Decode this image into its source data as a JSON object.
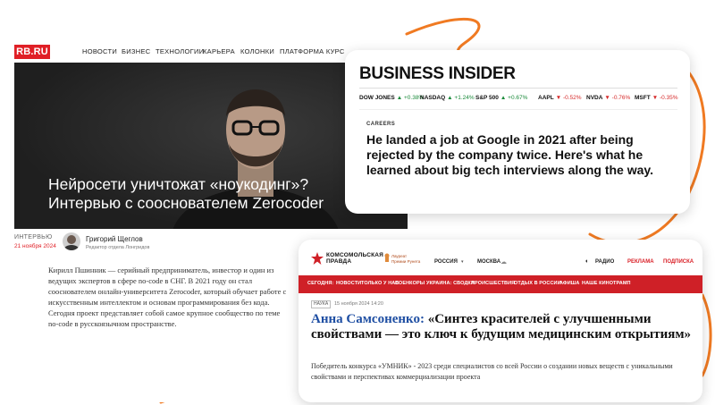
{
  "colors": {
    "accent_orange": "#f07a22",
    "rb_red": "#e01f26",
    "kp_red": "#cf2027",
    "bi_green": "#1a8a3a",
    "bi_red": "#d62b2b"
  },
  "rb": {
    "logo": "RB.RU",
    "nav": [
      "НОВОСТИ",
      "БИЗНЕС",
      "ТЕХНОЛОГИИ",
      "КАРЬЕРА",
      "КОЛОНКИ",
      "ПЛАТФОРМА КУРС"
    ],
    "headline_line1": "Нейросети уничтожат «ноукодинг»?",
    "headline_line2": "Интервью с сооснователем Zerocoder",
    "rubric": "ИНТЕРВЬЮ",
    "date": "21 ноября 2024",
    "author": "Григорий Щеглов",
    "author_role": "Редактор отдела Лонгридов",
    "lead": "Кирилл Пшинник — серийный предприниматель, инвестор и один из ведущих экспертов в сфере no-code в СНГ. В 2021 году он стал сооснователем онлайн-университета Zerocoder, который обучает работе с искусственным интеллектом и основам программирования без кода. Сегодня проект представляет собой самое крупное сообщество по теме no-code в русскоязычном пространстве."
  },
  "bi": {
    "logo": "BUSINESS INSIDER",
    "tickers": [
      {
        "name": "DOW JONES",
        "change": "+0.38%",
        "dir": "up"
      },
      {
        "name": "NASDAQ",
        "change": "+1.24%",
        "dir": "up"
      },
      {
        "name": "S&P 500",
        "change": "+0.67%",
        "dir": "up"
      },
      {
        "name": "AAPL",
        "change": "-0.52%",
        "dir": "down"
      },
      {
        "name": "NVDA",
        "change": "-0.76%",
        "dir": "down"
      },
      {
        "name": "MSFT",
        "change": "-0.35%",
        "dir": "down"
      }
    ],
    "section": "CAREERS",
    "title": "He landed a job at Google in 2021 after being rejected by the company twice. Here's what he learned about big tech interviews along the way."
  },
  "kp": {
    "logo_line1": "КОМСОМОЛЬСКАЯ",
    "logo_line2": "ПРАВДА",
    "prize_line1": "Лауреат",
    "prize_line2": "Премии Рунета",
    "region": "РОССИЯ",
    "city": "МОСКВА",
    "radio": "РАДИО",
    "ads": "РЕКЛАМА",
    "subscribe": "ПОДПИСКА",
    "nav": [
      "СЕГОДНЯ:",
      "НОВОСТИ",
      "ТОЛЬКО У НАС",
      "ВОЕНКОРЫ",
      "УКРАИНА: СВОДКА",
      "ПРОИСШЕСТВИЯ",
      "ОТДЫХ В РОССИИ",
      "АФИША",
      "НАШЕ КИНО",
      "ТРАМП"
    ],
    "badge": "НАУКА",
    "date": "15 ноября 2024 14:20",
    "title_name": "Анна Самсоненко:",
    "title_rest": "«Синтез красителей с улучшенными свойствами — это ключ к будущим медицинским открытиям»",
    "lead": "Победитель конкурса «УМНИК» - 2023 среди специалистов со всей России о создании новых веществ с уникальными свойствами и перспективах коммерциализации проекта"
  }
}
